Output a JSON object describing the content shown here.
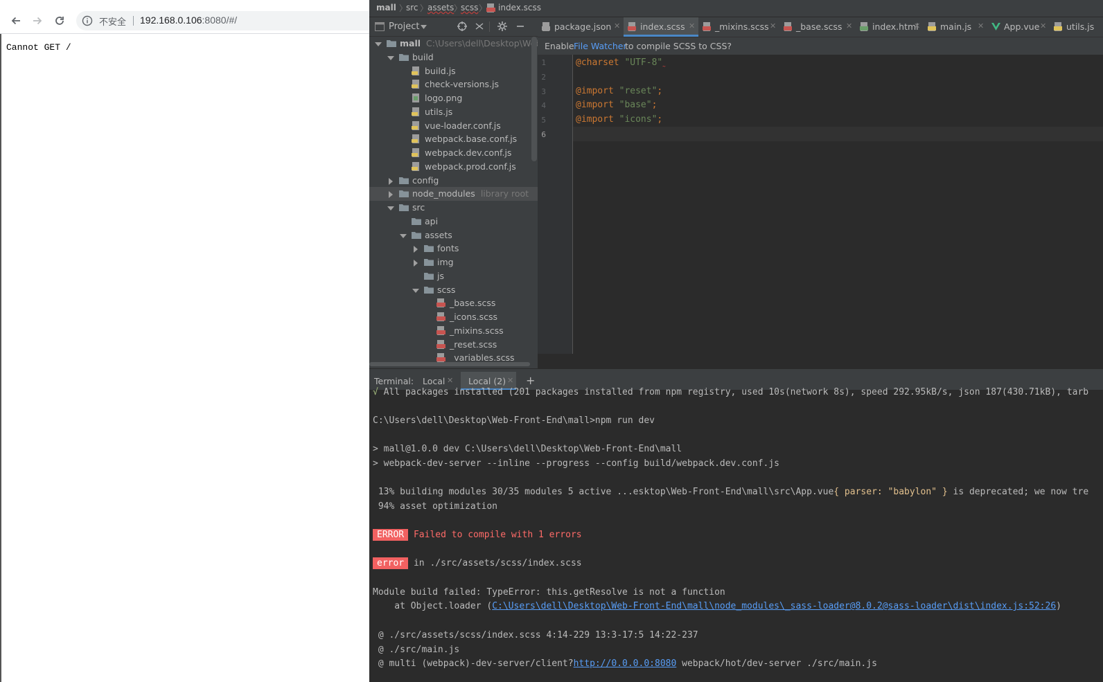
{
  "browser": {
    "insecure_label": "不安全",
    "url_host": "192.168.0.106",
    "url_rest": ":8080/#/",
    "page_text": "Cannot GET /"
  },
  "ide": {
    "breadcrumbs": [
      "mall",
      "src",
      "assets",
      "scss",
      "index.scss"
    ],
    "project_panel": {
      "title": "Project",
      "tree": [
        {
          "label": "mall",
          "hint": "C:\\Users\\dell\\Desktop\\Web-F",
          "type": "folder",
          "depth": 0,
          "expanded": true
        },
        {
          "label": "build",
          "type": "folder",
          "depth": 1,
          "expanded": true
        },
        {
          "label": "build.js",
          "type": "js",
          "depth": 2
        },
        {
          "label": "check-versions.js",
          "type": "js",
          "depth": 2
        },
        {
          "label": "logo.png",
          "type": "png",
          "depth": 2
        },
        {
          "label": "utils.js",
          "type": "js",
          "depth": 2
        },
        {
          "label": "vue-loader.conf.js",
          "type": "js",
          "depth": 2
        },
        {
          "label": "webpack.base.conf.js",
          "type": "js",
          "depth": 2
        },
        {
          "label": "webpack.dev.conf.js",
          "type": "js",
          "depth": 2
        },
        {
          "label": "webpack.prod.conf.js",
          "type": "js",
          "depth": 2
        },
        {
          "label": "config",
          "type": "folder",
          "depth": 1,
          "expanded": false
        },
        {
          "label": "node_modules",
          "hint": "library root",
          "type": "folder",
          "depth": 1,
          "expanded": false
        },
        {
          "label": "src",
          "type": "folder",
          "depth": 1,
          "expanded": true
        },
        {
          "label": "api",
          "type": "folder",
          "depth": 2,
          "leaf": true
        },
        {
          "label": "assets",
          "type": "folder",
          "depth": 2,
          "expanded": true
        },
        {
          "label": "fonts",
          "type": "folder",
          "depth": 3,
          "expanded": false
        },
        {
          "label": "img",
          "type": "folder",
          "depth": 3,
          "expanded": false
        },
        {
          "label": "js",
          "type": "folder",
          "depth": 3,
          "leaf": true
        },
        {
          "label": "scss",
          "type": "folder",
          "depth": 3,
          "expanded": true
        },
        {
          "label": "_base.scss",
          "type": "sass",
          "depth": 4
        },
        {
          "label": "_icons.scss",
          "type": "sass",
          "depth": 4
        },
        {
          "label": "_mixins.scss",
          "type": "sass",
          "depth": 4
        },
        {
          "label": "_reset.scss",
          "type": "sass",
          "depth": 4
        },
        {
          "label": "_variables.scss",
          "type": "sass",
          "depth": 4
        }
      ]
    },
    "tabs": [
      {
        "label": "package.json",
        "type": "json"
      },
      {
        "label": "index.scss",
        "type": "sass",
        "active": true
      },
      {
        "label": "_mixins.scss",
        "type": "sass"
      },
      {
        "label": "_base.scss",
        "type": "sass"
      },
      {
        "label": "index.html",
        "type": "html"
      },
      {
        "label": "main.js",
        "type": "js"
      },
      {
        "label": "App.vue",
        "type": "vue"
      },
      {
        "label": "utils.js",
        "type": "js"
      }
    ],
    "banner": {
      "pre": "Enable",
      "link": "File Watcher",
      "post": "to compile SCSS to CSS?"
    },
    "code": {
      "line_numbers": [
        "1",
        "2",
        "3",
        "4",
        "5",
        "6"
      ],
      "lines": [
        {
          "kw": "@charset",
          "str": "\"UTF-8\""
        },
        {
          "kw": "",
          "str": ""
        },
        {
          "kw": "@import",
          "str": "\"reset\"",
          "end": ";"
        },
        {
          "kw": "@import",
          "str": "\"base\"",
          "end": ";"
        },
        {
          "kw": "@import",
          "str": "\"icons\"",
          "end": ";"
        },
        {
          "kw": "",
          "str": ""
        }
      ]
    },
    "terminal": {
      "label": "Terminal:",
      "tabs": [
        "Local",
        "Local (2)"
      ],
      "add": "+",
      "l1_check": "√",
      "l1": " All packages installed (201 packages installed from npm registry, used 10s(network 8s), speed 292.95kB/s, json 187(430.71kB), tarb",
      "l2": "C:\\Users\\dell\\Desktop\\Web-Front-End\\mall>npm run dev",
      "l3": "> mall@1.0.0 dev C:\\Users\\dell\\Desktop\\Web-Front-End\\mall",
      "l4": "> webpack-dev-server --inline --progress --config build/webpack.dev.conf.js",
      "l5a": " 13% building modules 30/35 modules 5 active ...esktop\\Web-Front-End\\mall\\src\\App.vue",
      "l5b": "{ parser: ",
      "l5c": "\"babylon\"",
      "l5d": " }",
      "l5e": " is deprecated; we now tre",
      "l6": " 94% asset optimization",
      "err_badge": "ERROR",
      "err_msg": "Failed to compile with 1 errors",
      "err_badge2": "error",
      "err_in": "in ./src/assets/scss/index.scss",
      "l9": "Module build failed: TypeError: this.getResolve is not a function",
      "l10a": "    at Object.loader (",
      "l10link": "C:\\Users\\dell\\Desktop\\Web-Front-End\\mall\\node_modules\\_sass-loader@8.0.2@sass-loader\\dist\\index.js:52:26",
      "l10b": ")",
      "l11": " @ ./src/assets/scss/index.scss 4:14-229 13:3-17:5 14:22-237",
      "l12": " @ ./src/main.js",
      "l13a": " @ multi (webpack)-dev-server/client?",
      "l13link": "http://0.0.0.0:8080",
      "l13b": " webpack/hot/dev-server ./src/main.js"
    }
  }
}
